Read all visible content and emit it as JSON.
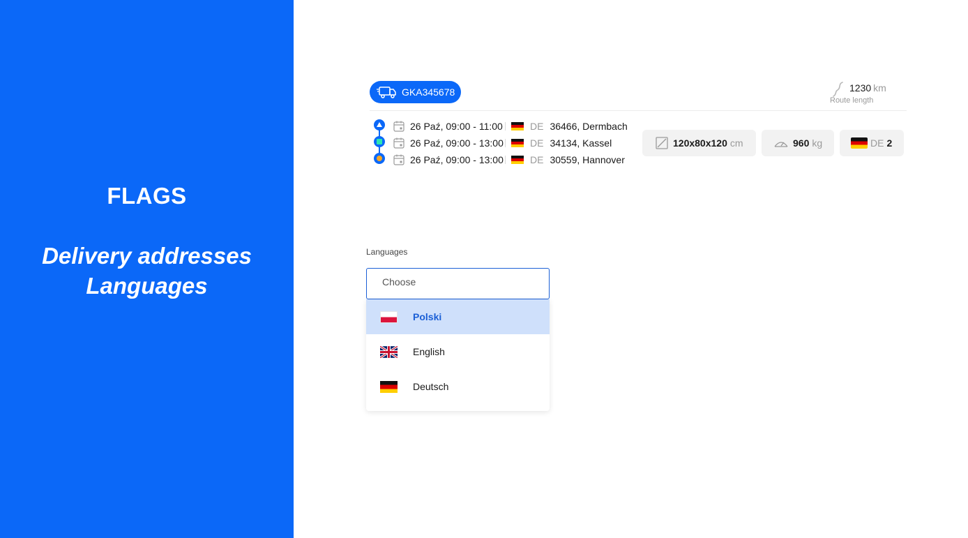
{
  "left_panel": {
    "title": "FLAGS",
    "subtitle_line1": "Delivery addresses",
    "subtitle_line2": "Languages",
    "background": "#0b68f8"
  },
  "route_card": {
    "vehicle_plate": "GKA345678",
    "route_length": {
      "value": "1230",
      "unit": "km",
      "label": "Route length"
    },
    "stops": [
      {
        "datetime": "26 Paź, 09:00 - 11:00",
        "country": "DE",
        "address": "36466, Dermbach",
        "marker": "start"
      },
      {
        "datetime": "26 Paź, 09:00 - 13:00",
        "country": "DE",
        "address": "34134, Kassel",
        "marker": "stop"
      },
      {
        "datetime": "26 Paź, 09:00 - 13:00",
        "country": "DE",
        "address": "30559, Hannover",
        "marker": "end"
      }
    ],
    "dimensions": {
      "value": "120x80x120",
      "unit": "cm"
    },
    "weight": {
      "value": "960",
      "unit": "kg"
    },
    "countries": {
      "code": "DE",
      "count": "2"
    }
  },
  "languages": {
    "label": "Languages",
    "placeholder": "Choose",
    "options": [
      {
        "label": "Polski",
        "flag": "pl-flag",
        "highlighted": true
      },
      {
        "label": "English",
        "flag": "gb-flag",
        "highlighted": false
      },
      {
        "label": "Deutsch",
        "flag": "de-flag",
        "highlighted": false
      }
    ]
  },
  "colors": {
    "accent": "#0b68f8",
    "highlight": "#cfe0fb",
    "marker_green": "#2ee6b0",
    "marker_orange": "#f5a623"
  }
}
